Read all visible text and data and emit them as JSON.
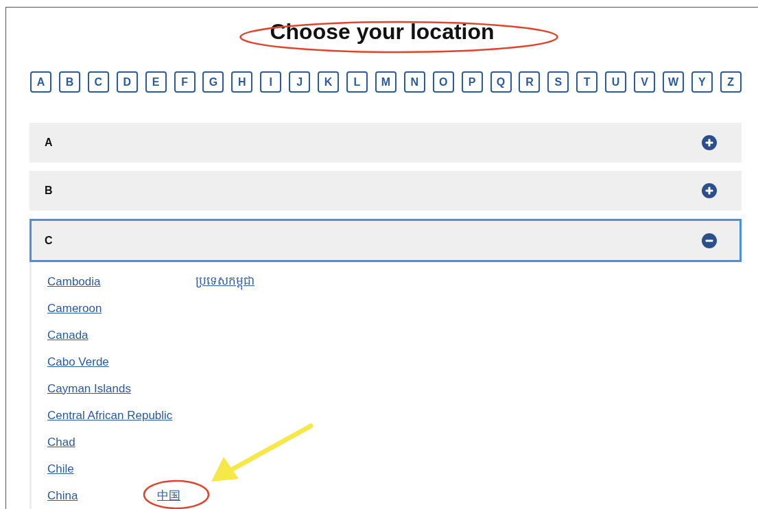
{
  "title": {
    "text": "Choose your location",
    "circled": true
  },
  "letters": [
    "A",
    "B",
    "C",
    "D",
    "E",
    "F",
    "G",
    "H",
    "I",
    "J",
    "K",
    "L",
    "M",
    "N",
    "O",
    "P",
    "Q",
    "R",
    "S",
    "T",
    "U",
    "V",
    "W",
    "Y",
    "Z"
  ],
  "sections": [
    {
      "label": "A",
      "expanded": false
    },
    {
      "label": "B",
      "expanded": false
    },
    {
      "label": "C",
      "expanded": true,
      "countries": [
        {
          "name": "Cambodia",
          "native_name": "ប្រទេសកម្ពុជា"
        },
        {
          "name": "Cameroon"
        },
        {
          "name": "Canada"
        },
        {
          "name": "Cabo Verde"
        },
        {
          "name": "Cayman Islands"
        },
        {
          "name": "Central African Republic"
        },
        {
          "name": "Chad"
        },
        {
          "name": "Chile"
        },
        {
          "name": "China",
          "native_name": "中国",
          "native_circled": true
        }
      ]
    }
  ]
}
